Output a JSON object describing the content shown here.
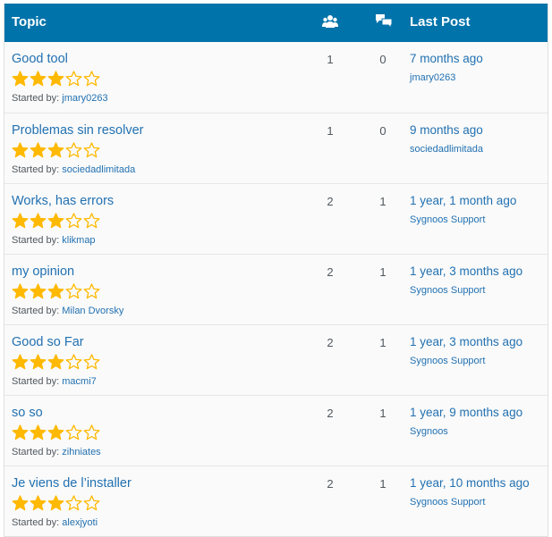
{
  "header": {
    "topic_label": "Topic",
    "voices_icon": "participants-icon",
    "posts_icon": "replies-icon",
    "last_post_label": "Last Post"
  },
  "colors": {
    "header_bg": "#0073aa",
    "link": "#2271b1",
    "star": "#ffb900"
  },
  "started_prefix": "Started by: ",
  "topics": [
    {
      "title": "Good tool",
      "rating": 3,
      "author": "jmary0263",
      "voices": "1",
      "posts": "0",
      "freshness": "7 months ago",
      "last_user": "jmary0263"
    },
    {
      "title": "Problemas sin resolver",
      "rating": 3,
      "author": "sociedadlimitada",
      "voices": "1",
      "posts": "0",
      "freshness": "9 months ago",
      "last_user": "sociedadlimitada"
    },
    {
      "title": "Works, has errors",
      "rating": 3,
      "author": "klikmap",
      "voices": "2",
      "posts": "1",
      "freshness": "1 year, 1 month ago",
      "last_user": "Sygnoos Support"
    },
    {
      "title": "my opinion",
      "rating": 3,
      "author": "Milan Dvorsky",
      "voices": "2",
      "posts": "1",
      "freshness": "1 year, 3 months ago",
      "last_user": "Sygnoos Support"
    },
    {
      "title": "Good so Far",
      "rating": 3,
      "author": "macmi7",
      "voices": "2",
      "posts": "1",
      "freshness": "1 year, 3 months ago",
      "last_user": "Sygnoos Support"
    },
    {
      "title": "so so",
      "rating": 3,
      "author": "zihniates",
      "voices": "2",
      "posts": "1",
      "freshness": "1 year, 9 months ago",
      "last_user": "Sygnoos"
    },
    {
      "title": "Je viens de l’installer",
      "rating": 3,
      "author": "alexjyoti",
      "voices": "2",
      "posts": "1",
      "freshness": "1 year, 10 months ago",
      "last_user": "Sygnoos Support"
    }
  ]
}
